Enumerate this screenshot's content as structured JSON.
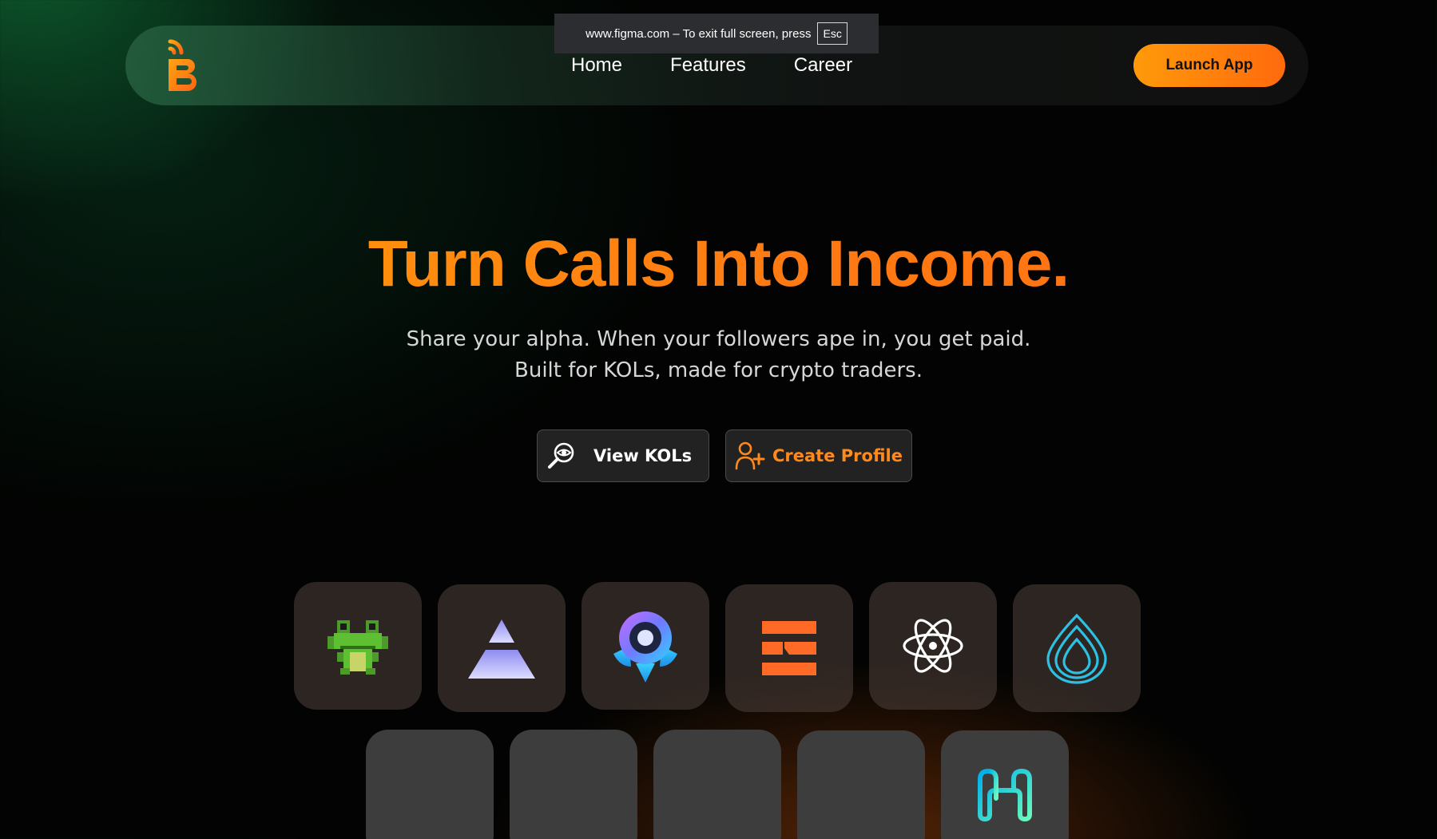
{
  "browser_notice": {
    "text": "www.figma.com – To exit full screen, press",
    "key": "Esc"
  },
  "nav": {
    "logo_icon": "b-signal-logo",
    "links": [
      "Home",
      "Features",
      "Career"
    ],
    "launch_label": "Launch App"
  },
  "hero": {
    "title": "Turn Calls Into Income.",
    "subtitle_line1": "Share your alpha. When your followers ape in, you get paid.",
    "subtitle_line2": "Built for KOLs, made for crypto traders."
  },
  "actions": {
    "view_label": "View KOLs",
    "view_icon": "search-eye-icon",
    "create_label": "Create Profile",
    "create_icon": "add-user-icon"
  },
  "tokens": {
    "row1": [
      "pixel-frog-icon",
      "triangle-pyramid-icon",
      "rocket-eye-icon",
      "orange-bars-icon",
      "atom-icon",
      "water-drop-icon"
    ],
    "row2": [
      "blank",
      "blank",
      "blank",
      "blank",
      "harmony-h-icon"
    ]
  },
  "colors": {
    "accent_orange": "#ff8a0f",
    "cta_orange": "#ff7a12",
    "background": "#020302"
  }
}
